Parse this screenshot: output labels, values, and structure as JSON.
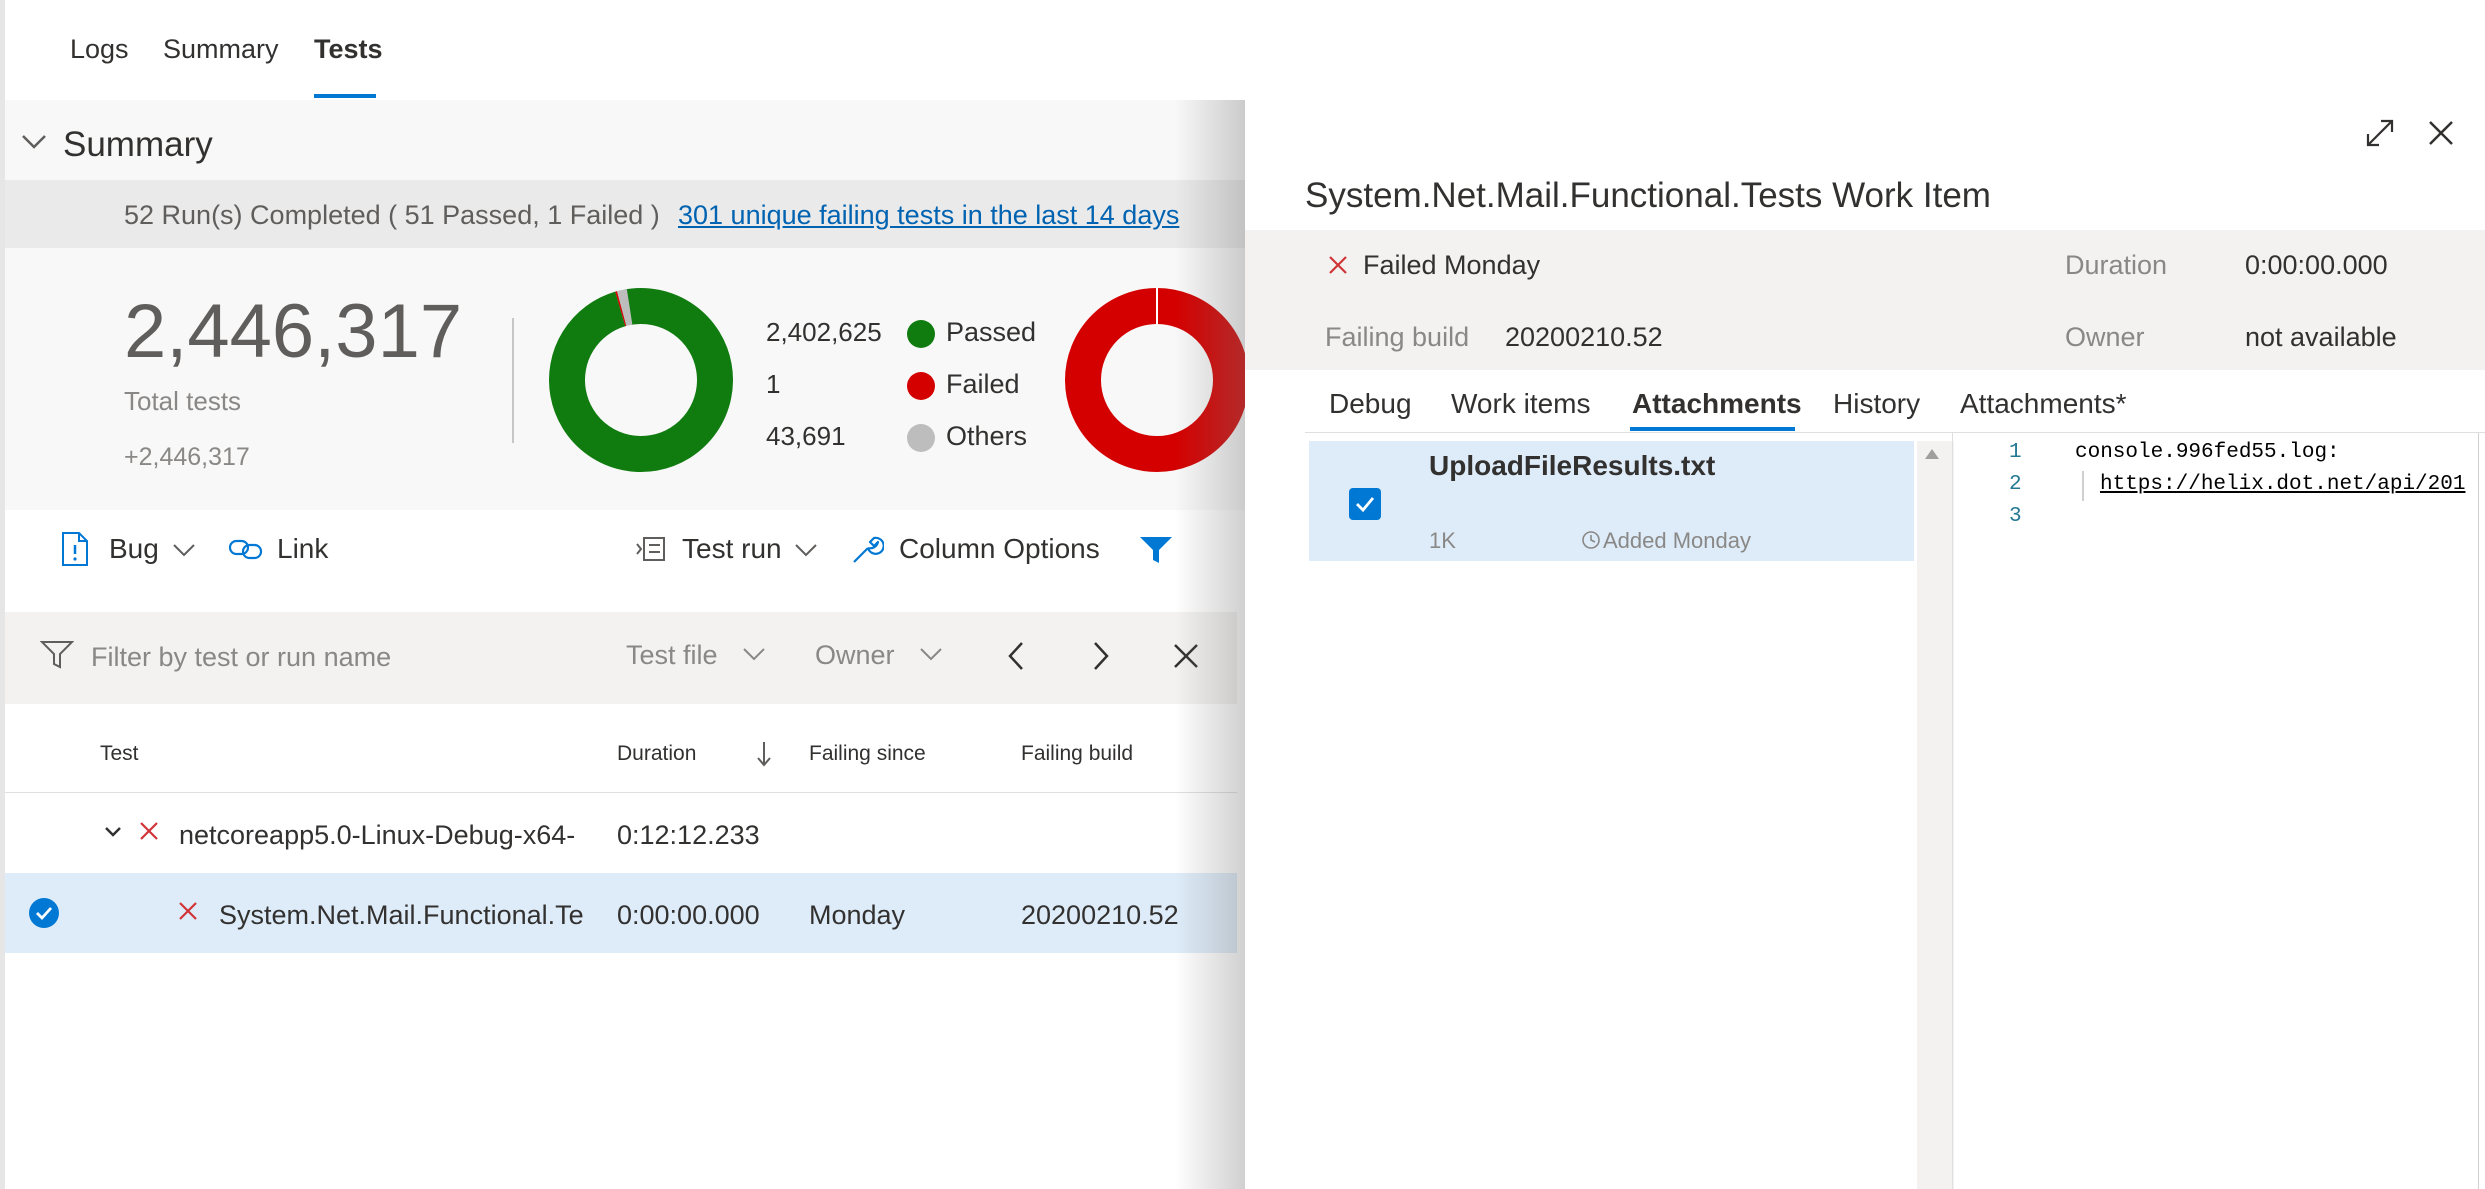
{
  "top_tabs": [
    "Logs",
    "Summary",
    "Tests"
  ],
  "summary": {
    "title": "Summary",
    "runs_text": "52 Run(s) Completed ( 51 Passed, 1 Failed )",
    "failing_link": "301 unique failing tests in the last 14 days",
    "total_tests": "2,446,317",
    "total_label": "Total tests",
    "total_delta": "+2,446,317",
    "legend": [
      {
        "count": "2,402,625",
        "label": "Passed",
        "color": "#107c10"
      },
      {
        "count": "1",
        "label": "Failed",
        "color": "#d40000"
      },
      {
        "count": "43,691",
        "label": "Others",
        "color": "#bdbdbd"
      }
    ],
    "chart_data": {
      "type": "pie",
      "categories": [
        "Passed",
        "Failed",
        "Others"
      ],
      "values": [
        2402625,
        1,
        43691
      ]
    }
  },
  "toolbar": {
    "bug": "Bug",
    "link": "Link",
    "test_run": "Test run",
    "column_options": "Column Options"
  },
  "filter": {
    "placeholder": "Filter by test or run name",
    "test_file": "Test file",
    "owner": "Owner"
  },
  "table": {
    "headers": {
      "test": "Test",
      "duration": "Duration",
      "failing_since": "Failing since",
      "failing_build": "Failing build"
    },
    "group_row": {
      "name": "netcoreapp5.0-Linux-Debug-x64-",
      "duration": "0:12:12.233"
    },
    "selected_row": {
      "name": "System.Net.Mail.Functional.Te",
      "duration": "0:00:00.000",
      "failing_since": "Monday",
      "failing_build": "20200210.52"
    }
  },
  "detail": {
    "title": "System.Net.Mail.Functional.Tests Work Item",
    "status": "Failed Monday",
    "duration_label": "Duration",
    "duration_value": "0:00:00.000",
    "failing_build_label": "Failing build",
    "failing_build_value": "20200210.52",
    "owner_label": "Owner",
    "owner_value": "not available",
    "tabs": [
      "Debug",
      "Work items",
      "Attachments",
      "History",
      "Attachments*"
    ],
    "attachment": {
      "name": "UploadFileResults.txt",
      "size": "1K",
      "added": "Added Monday"
    },
    "code_lines": [
      {
        "n": "1",
        "text": "console.996fed55.log:"
      },
      {
        "n": "2",
        "text": "https://helix.dot.net/api/201"
      },
      {
        "n": "3",
        "text": ""
      }
    ]
  }
}
